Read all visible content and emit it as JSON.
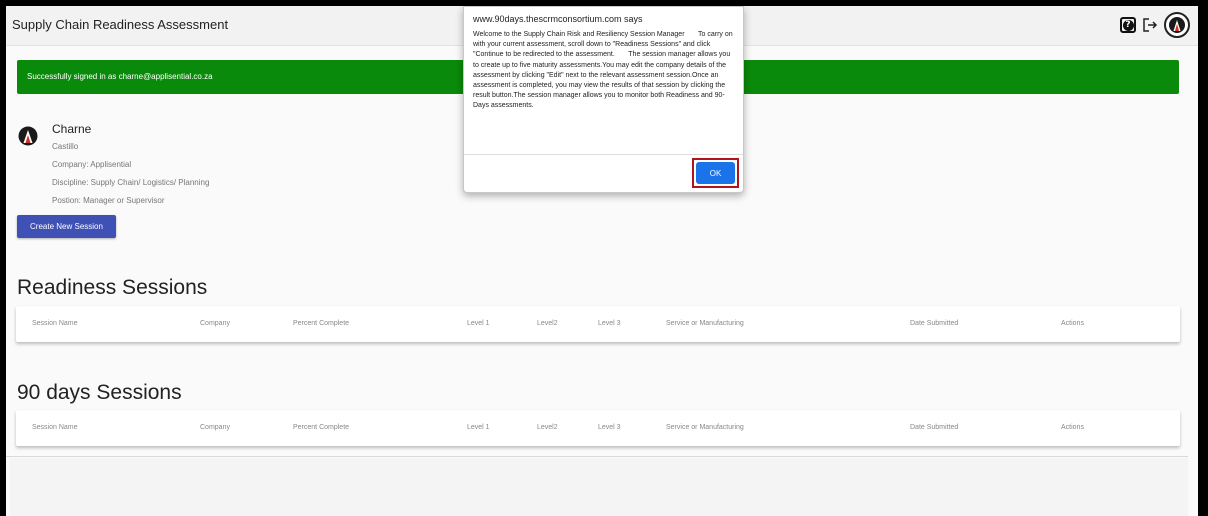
{
  "header": {
    "title": "Supply Chain Readiness Assessment",
    "help_glyph": "?"
  },
  "alert": {
    "message": "Successfully signed in as charne@applisential.co.za",
    "color": "#0a8a0a"
  },
  "user": {
    "name": "Charne",
    "surname": "Castillo",
    "company": "Company: Applisential",
    "discipline": "Discipline: Supply Chain/ Logistics/ Planning",
    "position": "Postion: Manager or Supervisor"
  },
  "actions": {
    "create_session_label": "Create New Session",
    "accent": "#3f51b5"
  },
  "columns": [
    "Session Name",
    "Company",
    "Percent Complete",
    "Level 1",
    "Level2",
    "Level 3",
    "Service or Manufacturing",
    "Date Submitted",
    "Actions"
  ],
  "readiness": {
    "title": "Readiness Sessions"
  },
  "ninety": {
    "title": "90 days Sessions"
  },
  "dialog": {
    "origin": "www.90days.thescrmconsortium.com says",
    "message": "Welcome to the Supply Chain Risk and Resiliency Session Manager       To carry on with your current assessment, scroll down to \"Readiness Sessions\" and click \"Continue to be redirected to the assessment.       The session manager allows you to create up to five maturity assessments.You may edit the company details of the assessment by clicking \"Edit\" next to the relevant assessment session.Once an assessment is completed, you may view the results of that session by clicking the result button.The session manager allows you to monitor both Readiness and 90-Days assessments.",
    "ok_label": "OK",
    "ok_color": "#1a73e8",
    "highlight_color": "#b3131b"
  }
}
